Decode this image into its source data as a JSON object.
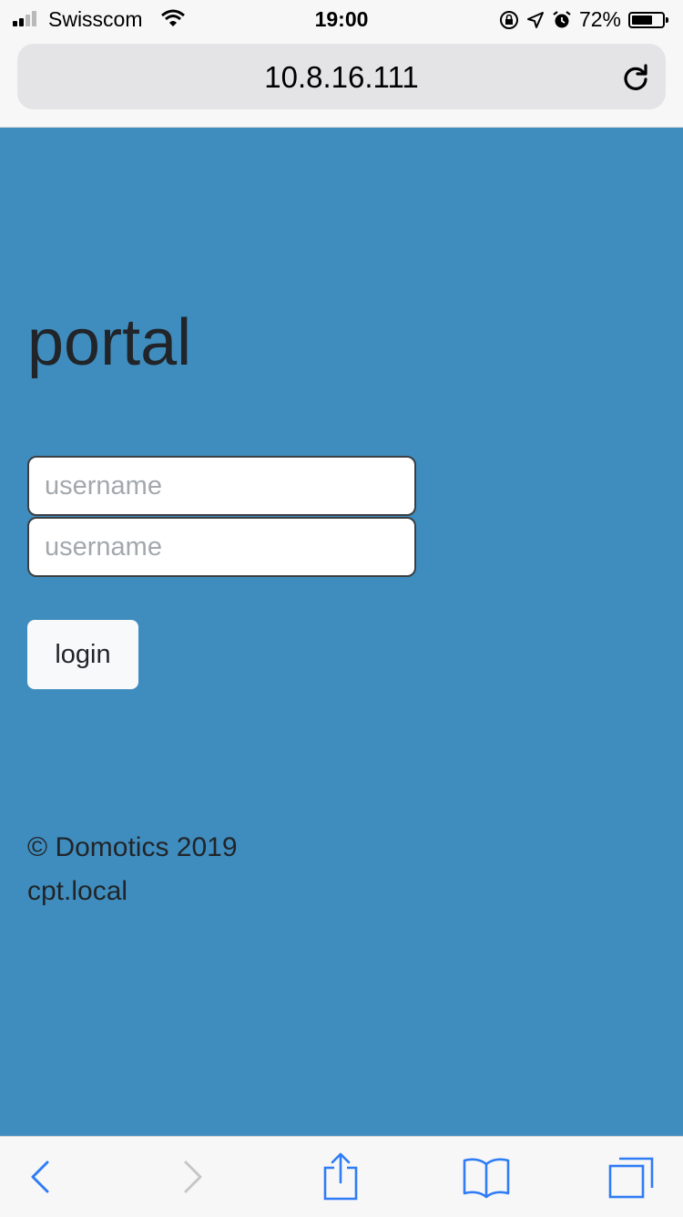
{
  "status_bar": {
    "carrier": "Swisscom",
    "time": "19:00",
    "battery_percent": "72%",
    "battery_level": 0.72,
    "icons": [
      "signal-icon",
      "wifi-icon",
      "orientation-lock-icon",
      "location-arrow-icon",
      "alarm-icon",
      "battery-icon"
    ]
  },
  "browser": {
    "url": "10.8.16.111",
    "reload_icon": "reload-icon"
  },
  "page": {
    "title": "portal",
    "username_placeholder": "username",
    "password_placeholder": "username",
    "login_label": "login",
    "footer_line1": "© Domotics 2019",
    "footer_line2": "cpt.local",
    "background_color": "#3f8dbf"
  },
  "toolbar": {
    "icons": [
      "back-icon",
      "forward-icon",
      "share-icon",
      "bookmarks-icon",
      "tabs-icon"
    ],
    "accent_color": "#2f7cf6"
  }
}
